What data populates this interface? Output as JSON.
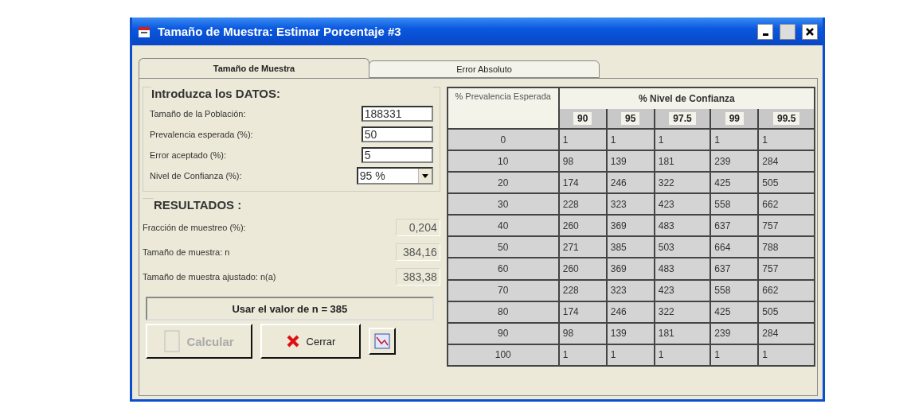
{
  "window": {
    "title": "Tamaño de Muestra: Estimar Porcentaje  #3"
  },
  "tabs": [
    {
      "label": "Tamaño de Muestra",
      "selected": true
    },
    {
      "label": "Error Absoluto",
      "selected": false
    }
  ],
  "input_group": {
    "title": "Introduzca los DATOS:",
    "fields": [
      {
        "kind": "text",
        "label": "Tamaño de la Población:",
        "value": "188331"
      },
      {
        "kind": "text",
        "label": "Prevalencia esperada (%):",
        "value": "50"
      },
      {
        "kind": "text",
        "label": "Error aceptado (%):",
        "value": "5"
      },
      {
        "kind": "select",
        "label": "Nivel de Confianza (%):",
        "value": "95 %"
      }
    ]
  },
  "results": {
    "title": "RESULTADOS :",
    "rows": [
      {
        "label": "Fracción de muestreo (%):",
        "value": "0,204"
      },
      {
        "label": "Tamaño de muestra: n",
        "value": "384,16"
      },
      {
        "label": "Tamaño de muestra ajustado: n(a)",
        "value": "383,38"
      }
    ]
  },
  "use_value_button": "Usar el valor de n = 385",
  "buttons": [
    {
      "kind": "calculate",
      "label": "Calcular",
      "disabled": true
    },
    {
      "kind": "close",
      "label": "Cerrar",
      "disabled": false
    },
    {
      "kind": "chart"
    }
  ],
  "table": {
    "row_header": "% Prevalencia Esperada",
    "group_header": "% Nivel de Confianza",
    "levels": [
      "90",
      "95",
      "97.5",
      "99",
      "99.5"
    ],
    "rows": [
      {
        "prevalence": "0",
        "values": [
          "1",
          "1",
          "1",
          "1",
          "1"
        ]
      },
      {
        "prevalence": "10",
        "values": [
          "98",
          "139",
          "181",
          "239",
          "284"
        ]
      },
      {
        "prevalence": "20",
        "values": [
          "174",
          "246",
          "322",
          "425",
          "505"
        ]
      },
      {
        "prevalence": "30",
        "values": [
          "228",
          "323",
          "423",
          "558",
          "662"
        ]
      },
      {
        "prevalence": "40",
        "values": [
          "260",
          "369",
          "483",
          "637",
          "757"
        ]
      },
      {
        "prevalence": "50",
        "values": [
          "271",
          "385",
          "503",
          "664",
          "788"
        ]
      },
      {
        "prevalence": "60",
        "values": [
          "260",
          "369",
          "483",
          "637",
          "757"
        ]
      },
      {
        "prevalence": "70",
        "values": [
          "228",
          "323",
          "423",
          "558",
          "662"
        ]
      },
      {
        "prevalence": "80",
        "values": [
          "174",
          "246",
          "322",
          "425",
          "505"
        ]
      },
      {
        "prevalence": "90",
        "values": [
          "98",
          "139",
          "181",
          "239",
          "284"
        ]
      },
      {
        "prevalence": "100",
        "values": [
          "1",
          "1",
          "1",
          "1",
          "1"
        ]
      }
    ]
  }
}
